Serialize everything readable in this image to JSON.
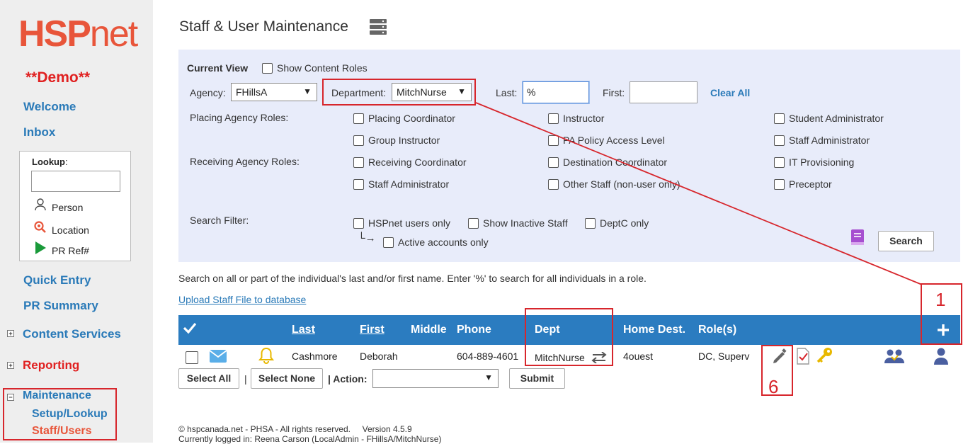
{
  "sidebar": {
    "logo_bold": "HSP",
    "logo_rest": "net",
    "demo": "**Demo**",
    "welcome": "Welcome",
    "inbox": "Inbox",
    "lookup_label": "Lookup",
    "lookup_colon": ":",
    "lookup_items": [
      "Person",
      "Location",
      "PR Ref#"
    ],
    "quick_entry": "Quick Entry",
    "pr_summary": "PR Summary",
    "content_services": "Content Services",
    "reporting": "Reporting",
    "maintenance": "Maintenance",
    "setup_lookup": "Setup/Lookup",
    "staff_users": "Staff/Users"
  },
  "header": {
    "title": "Staff & User Maintenance"
  },
  "current_view": {
    "heading": "Current View",
    "show_content_roles": "Show Content Roles",
    "agency_label": "Agency:",
    "agency_value": "FHillsA",
    "department_label": "Department:",
    "department_value": "MitchNurse",
    "last_label": "Last:",
    "last_value": "%",
    "first_label": "First:",
    "first_value": "",
    "clear_all": "Clear All",
    "placing_roles_label": "Placing Agency Roles:",
    "receiving_roles_label": "Receiving Agency Roles:",
    "roles": {
      "col1": [
        "Placing Coordinator",
        "Group Instructor",
        "Receiving Coordinator",
        "Staff Administrator"
      ],
      "col2": [
        "Instructor",
        "PA Policy Access Level",
        "Destination Coordinator",
        "Other Staff (non-user only)"
      ],
      "col3": [
        "Student Administrator",
        "Staff Administrator",
        "IT Provisioning",
        "Preceptor"
      ]
    },
    "search_filter_label": "Search Filter:",
    "filters": [
      "HSPnet users only",
      "Show Inactive Staff",
      "DeptC only"
    ],
    "active_accounts": "Active accounts only",
    "search_button": "Search"
  },
  "hint": "Search on all or part of the individual's last and/or first name. Enter '%' to search for all individuals in a role.",
  "upload_link": "Upload Staff File to database",
  "table": {
    "headers": {
      "last": "Last",
      "first": "First",
      "middle": "Middle",
      "phone": "Phone",
      "dept": "Dept",
      "home_dest": "Home Dest.",
      "roles": "Role(s)"
    },
    "row": {
      "last": "Cashmore",
      "first": "Deborah",
      "phone": "604-889-4601",
      "dept": "MitchNurse",
      "home_dest": "4ouest",
      "roles": "DC, Superv"
    }
  },
  "actions": {
    "select_all": "Select All",
    "select_none": "Select None",
    "sep": "|",
    "action_label": "| Action:",
    "submit": "Submit"
  },
  "annotations": {
    "one": "1",
    "six": "6"
  },
  "footer": {
    "copyright": "© hspcanada.net - PHSA - All rights reserved.     Version 4.5.9",
    "logged_in": "Currently logged in: Reena Carson (LocalAdmin - FHillsA/MitchNurse)"
  },
  "colors": {
    "brand_orange": "#e8553a",
    "link_blue": "#2a7ab8",
    "header_blue": "#2b7cc0",
    "annotation_red": "#d7262c",
    "panel_bg": "#e8ecfa"
  }
}
